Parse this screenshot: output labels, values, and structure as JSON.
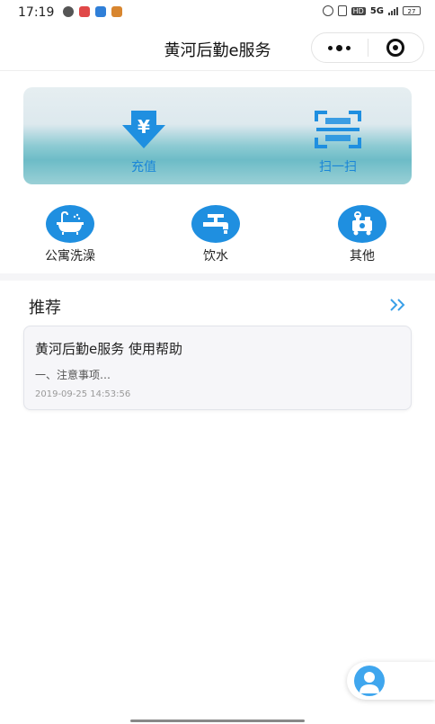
{
  "status": {
    "time": "17:19",
    "network": "5G",
    "battery": "27",
    "hd": "HD"
  },
  "header": {
    "title": "黄河后勤e服务"
  },
  "banner": {
    "recharge_label": "充值",
    "scan_label": "扫一扫"
  },
  "services": {
    "bath_label": "公寓洗澡",
    "water_label": "饮水",
    "other_label": "其他"
  },
  "recommend": {
    "title": "推荐",
    "article": {
      "title": "黄河后勤e服务 使用帮助",
      "summary": "一、注意事项…",
      "time": "2019-09-25 14:53:56"
    }
  },
  "colors": {
    "accent": "#1f8fe0",
    "banner_text": "#1a86d8",
    "arrow": "#3aa0e8"
  },
  "icons": {
    "recharge": "yen-icon",
    "scan": "scan-icon",
    "bath": "bathtub-icon",
    "water": "faucet-icon",
    "other": "appliance-icon",
    "more": "double-chevron-right-icon",
    "service": "customer-service-icon"
  }
}
